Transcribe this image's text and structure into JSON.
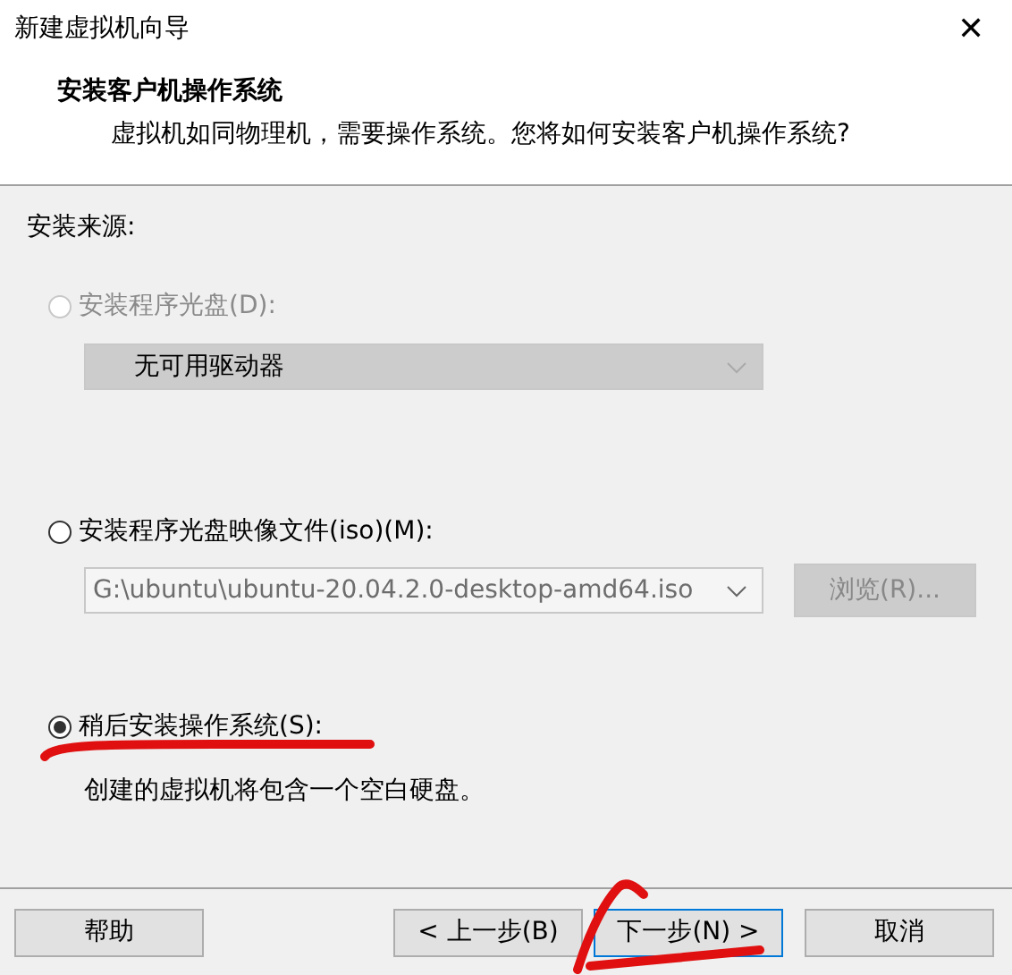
{
  "window": {
    "title": "新建虚拟机向导",
    "close": "✕"
  },
  "header": {
    "title": "安装客户机操作系统",
    "subtitle": "虚拟机如同物理机，需要操作系统。您将如何安装客户机操作系统?"
  },
  "source_label": "安装来源:",
  "options": [
    {
      "label": "安装程序光盘(D):",
      "selected": false,
      "disabled": true,
      "kind": "dropdown",
      "value": "无可用驱动器"
    },
    {
      "label": "安装程序光盘映像文件(iso)(M):",
      "selected": false,
      "disabled": false,
      "kind": "file",
      "value": "G:\\ubuntu\\ubuntu-20.04.2.0-desktop-amd64.iso",
      "browse": "浏览(R)..."
    },
    {
      "label": "稍后安装操作系统(S):",
      "selected": true,
      "disabled": false,
      "kind": "note",
      "note": "创建的虚拟机将包含一个空白硬盘。"
    }
  ],
  "buttons": [
    {
      "label": "帮助",
      "focused": false
    },
    {
      "label": "< 上一步(B)",
      "focused": false
    },
    {
      "label": "下一步(N) >",
      "focused": true
    },
    {
      "label": "取消",
      "focused": false
    }
  ],
  "annotations": {
    "underline": true,
    "scribble": true
  }
}
